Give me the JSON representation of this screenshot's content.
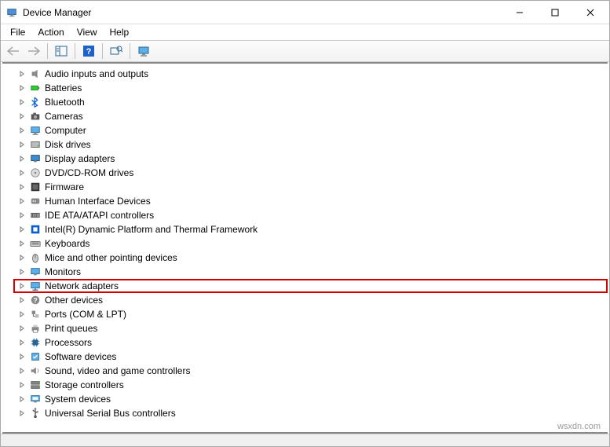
{
  "window": {
    "title": "Device Manager"
  },
  "menu": {
    "file": "File",
    "action": "Action",
    "view": "View",
    "help": "Help"
  },
  "tree": {
    "items": [
      {
        "label": "Audio inputs and outputs",
        "icon": "speaker"
      },
      {
        "label": "Batteries",
        "icon": "battery"
      },
      {
        "label": "Bluetooth",
        "icon": "bluetooth"
      },
      {
        "label": "Cameras",
        "icon": "camera"
      },
      {
        "label": "Computer",
        "icon": "computer"
      },
      {
        "label": "Disk drives",
        "icon": "disk"
      },
      {
        "label": "Display adapters",
        "icon": "display"
      },
      {
        "label": "DVD/CD-ROM drives",
        "icon": "cdrom"
      },
      {
        "label": "Firmware",
        "icon": "firmware"
      },
      {
        "label": "Human Interface Devices",
        "icon": "hid"
      },
      {
        "label": "IDE ATA/ATAPI controllers",
        "icon": "ide"
      },
      {
        "label": "Intel(R) Dynamic Platform and Thermal Framework",
        "icon": "intel"
      },
      {
        "label": "Keyboards",
        "icon": "keyboard"
      },
      {
        "label": "Mice and other pointing devices",
        "icon": "mouse"
      },
      {
        "label": "Monitors",
        "icon": "monitor"
      },
      {
        "label": "Network adapters",
        "icon": "network",
        "highlight": true
      },
      {
        "label": "Other devices",
        "icon": "other"
      },
      {
        "label": "Ports (COM & LPT)",
        "icon": "ports"
      },
      {
        "label": "Print queues",
        "icon": "printer"
      },
      {
        "label": "Processors",
        "icon": "cpu"
      },
      {
        "label": "Software devices",
        "icon": "software"
      },
      {
        "label": "Sound, video and game controllers",
        "icon": "sound"
      },
      {
        "label": "Storage controllers",
        "icon": "storage"
      },
      {
        "label": "System devices",
        "icon": "system"
      },
      {
        "label": "Universal Serial Bus controllers",
        "icon": "usb"
      }
    ]
  },
  "watermark": "wsxdn.com"
}
